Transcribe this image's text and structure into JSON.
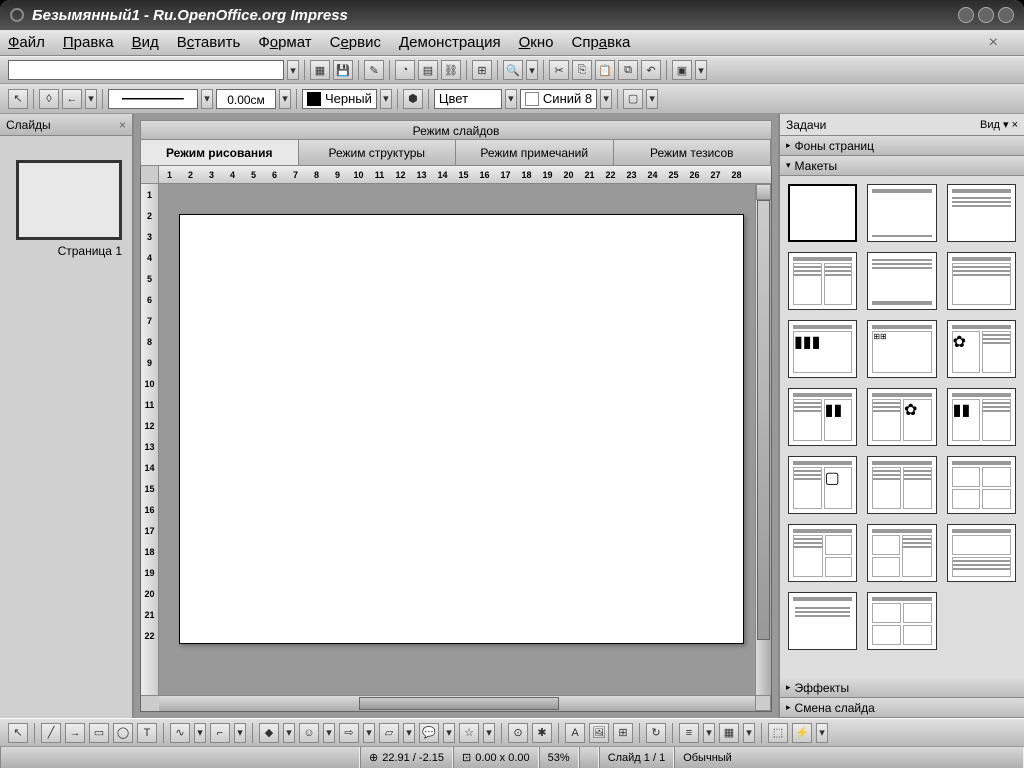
{
  "window": {
    "title": "Безымянный1 - Ru.OpenOffice.org Impress"
  },
  "menu": {
    "file": "Файл",
    "edit": "Правка",
    "view": "Вид",
    "insert": "Вставить",
    "format": "Формат",
    "tools": "Сервис",
    "slideshow": "Демонстрация",
    "window": "Окно",
    "help": "Справка"
  },
  "line": {
    "width": "0.00см",
    "colorName": "Черный",
    "fillLabel": "Цвет",
    "fillColor": "Синий 8"
  },
  "slides": {
    "title": "Слайды",
    "pageLabel": "Страница 1",
    "num": "1"
  },
  "center": {
    "modeHeader": "Режим слайдов",
    "tabs": [
      "Режим рисования",
      "Режим структуры",
      "Режим примечаний",
      "Режим тезисов"
    ]
  },
  "tasks": {
    "title": "Задачи",
    "view": "Вид",
    "sections": {
      "bg": "Фоны страниц",
      "layouts": "Макеты",
      "effects": "Эффекты",
      "transition": "Смена слайда"
    }
  },
  "status": {
    "coords": "22.91 / -2.15",
    "size": "0.00 x 0.00",
    "zoom": "53%",
    "slide": "Слайд 1 / 1",
    "mode": "Обычный"
  },
  "ruler": {
    "h": [
      "1",
      "2",
      "3",
      "4",
      "5",
      "6",
      "7",
      "8",
      "9",
      "10",
      "11",
      "12",
      "13",
      "14",
      "15",
      "16",
      "17",
      "18",
      "19",
      "20",
      "21",
      "22",
      "23",
      "24",
      "25",
      "26",
      "27",
      "28"
    ],
    "v": [
      "1",
      "2",
      "3",
      "4",
      "5",
      "6",
      "7",
      "8",
      "9",
      "10",
      "11",
      "12",
      "13",
      "14",
      "15",
      "16",
      "17",
      "18",
      "19",
      "20",
      "21",
      "22"
    ]
  }
}
